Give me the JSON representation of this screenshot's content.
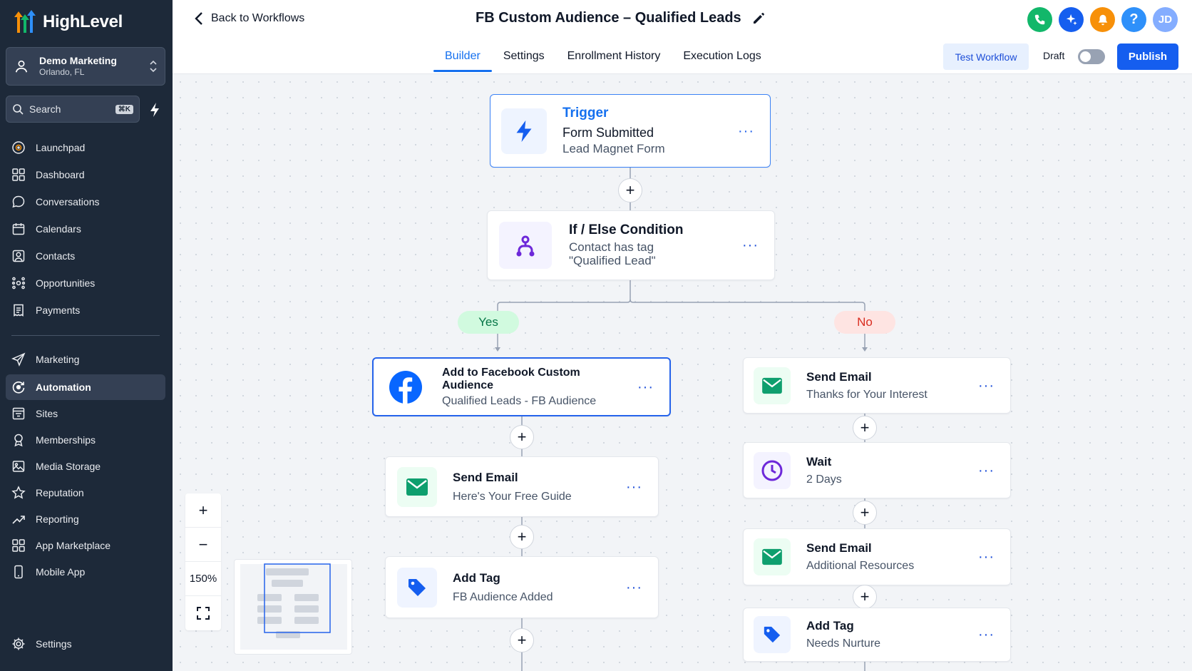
{
  "app": {
    "brand": "HighLevel"
  },
  "account": {
    "name": "Demo Marketing",
    "location": "Orlando, FL"
  },
  "search": {
    "label": "Search",
    "shortcut": "⌘K"
  },
  "nav": {
    "items": [
      {
        "label": "Launchpad",
        "icon": "launchpad-icon"
      },
      {
        "label": "Dashboard",
        "icon": "dashboard-icon"
      },
      {
        "label": "Conversations",
        "icon": "chat-icon"
      },
      {
        "label": "Calendars",
        "icon": "calendar-icon"
      },
      {
        "label": "Contacts",
        "icon": "contacts-icon"
      },
      {
        "label": "Opportunities",
        "icon": "opportunities-icon"
      },
      {
        "label": "Payments",
        "icon": "payments-icon"
      },
      {
        "label": "Marketing",
        "icon": "send-icon"
      },
      {
        "label": "Automation",
        "icon": "automation-icon"
      },
      {
        "label": "Sites",
        "icon": "sites-icon"
      },
      {
        "label": "Memberships",
        "icon": "award-icon"
      },
      {
        "label": "Media Storage",
        "icon": "image-icon"
      },
      {
        "label": "Reputation",
        "icon": "star-icon"
      },
      {
        "label": "Reporting",
        "icon": "trend-icon"
      },
      {
        "label": "App Marketplace",
        "icon": "grid-icon"
      },
      {
        "label": "Mobile App",
        "icon": "phone-icon"
      }
    ],
    "active": "Automation",
    "settings": "Settings"
  },
  "header": {
    "back": "Back to Workflows",
    "title": "FB Custom Audience – Qualified Leads",
    "tabs": [
      "Builder",
      "Settings",
      "Enrollment History",
      "Execution Logs"
    ],
    "active_tab": "Builder",
    "test_button": "Test Workflow",
    "status": "Draft",
    "publish": "Publish",
    "avatar": "JD",
    "help": "?"
  },
  "workflow": {
    "trigger": {
      "label": "Trigger",
      "title": "Form Submitted",
      "subtitle": "Lead Magnet Form"
    },
    "condition": {
      "title": "If / Else Condition",
      "line1": "Contact has tag",
      "line2": "\"Qualified Lead\""
    },
    "yes_label": "Yes",
    "no_label": "No",
    "yes_branch": [
      {
        "title": "Add to Facebook Custom Audience",
        "subtitle": "Qualified Leads - FB Audience"
      },
      {
        "title": "Send Email",
        "subtitle": "Here's Your Free Guide"
      },
      {
        "title": "Add Tag",
        "subtitle": "FB Audience Added"
      }
    ],
    "no_branch": [
      {
        "title": "Send Email",
        "subtitle": "Thanks for Your Interest"
      },
      {
        "title": "Wait",
        "subtitle": "2 Days"
      },
      {
        "title": "Send Email",
        "subtitle": "Additional Resources"
      },
      {
        "title": "Add Tag",
        "subtitle": "Needs Nurture"
      }
    ],
    "more": "···",
    "add": "+"
  },
  "zoom": {
    "in": "+",
    "out": "−",
    "level": "150%"
  },
  "colors": {
    "sidebar": "#1d2939",
    "accent": "#155eef",
    "yes": "#d1fadf",
    "no": "#fee4e2",
    "email_green": "#0e9f6e",
    "wait_purple": "#6d28d9"
  }
}
